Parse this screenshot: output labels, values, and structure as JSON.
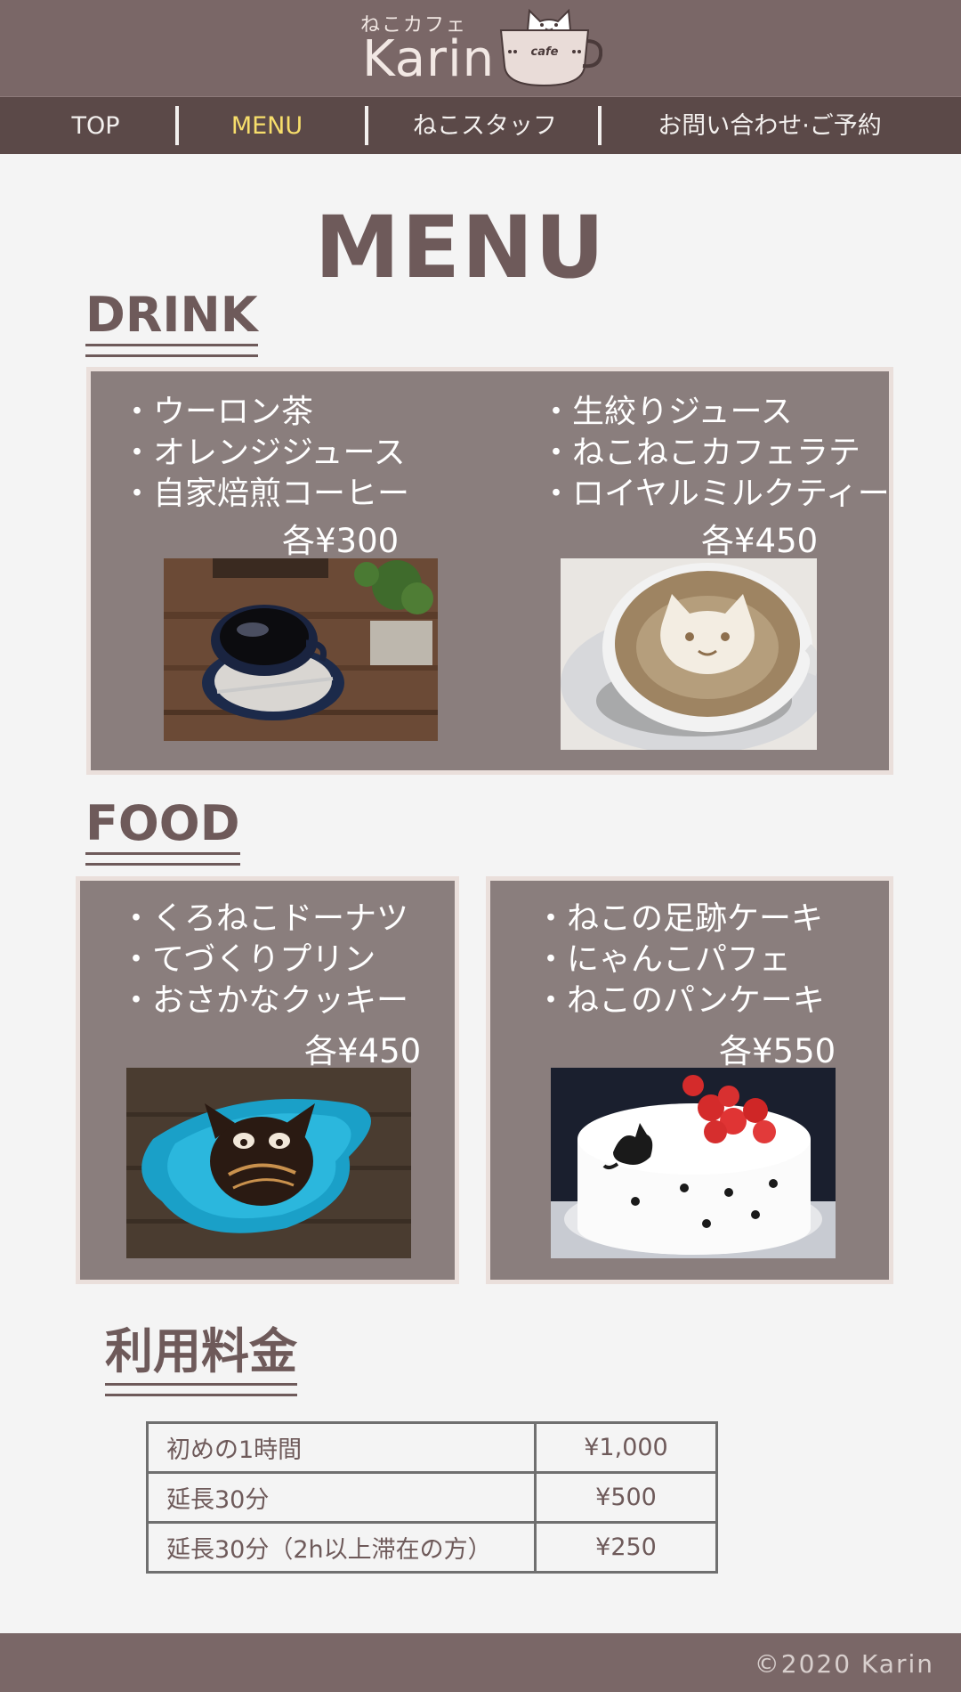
{
  "header": {
    "logo_sub": "ねこカフェ",
    "logo_name": "Karin",
    "cup_text": "cafe"
  },
  "nav": {
    "items": [
      {
        "label": "TOP",
        "active": false
      },
      {
        "label": "MENU",
        "active": true
      },
      {
        "label": "ねこスタッフ",
        "active": false
      },
      {
        "label": "お問い合わせ·ご予約",
        "active": false
      }
    ]
  },
  "page": {
    "title": "MENU"
  },
  "drink": {
    "title": "DRINK",
    "left": {
      "items": [
        "・ウーロン茶",
        "・オレンジジュース",
        "・自家焙煎コーヒー"
      ],
      "price": "各¥300",
      "image": "coffee-cup-photo"
    },
    "right": {
      "items": [
        "・生絞りジュース",
        "・ねこねこカフェラテ",
        "・ロイヤルミルクティー"
      ],
      "price": "各¥450",
      "image": "cat-latte-art-photo"
    }
  },
  "food": {
    "title": "FOOD",
    "left": {
      "items": [
        "・くろねこドーナツ",
        "・てづくりプリン",
        "・おさかなクッキー"
      ],
      "price": "各¥450",
      "image": "cat-donut-photo"
    },
    "right": {
      "items": [
        "・ねこの足跡ケーキ",
        "・にゃんこパフェ",
        "・ねこのパンケーキ"
      ],
      "price": "各¥550",
      "image": "cat-cake-photo"
    }
  },
  "fees": {
    "title": "利用料金",
    "rows": [
      {
        "label": "初めの1時間",
        "value": "¥1,000"
      },
      {
        "label": "延長30分",
        "value": "¥500"
      },
      {
        "label": "延長30分（2h以上滞在の方）",
        "value": "¥250"
      }
    ]
  },
  "footer": {
    "copyright": "©2020 Karin"
  },
  "colors": {
    "header_bg": "#7a6767",
    "nav_bg": "#5b4948",
    "nav_active": "#f7de6b",
    "panel_bg": "#8a7e7d",
    "text_brown": "#6e5a5a"
  }
}
